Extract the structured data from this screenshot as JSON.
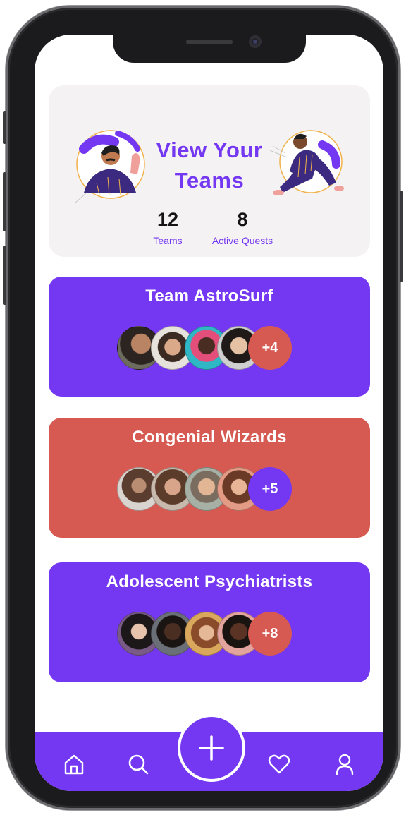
{
  "hero": {
    "title_line1": "View Your",
    "title_line2": "Teams",
    "stats": [
      {
        "value": "12",
        "label": "Teams"
      },
      {
        "value": "8",
        "label": "Active Quests"
      }
    ]
  },
  "teams": [
    {
      "name": "Team AstroSurf",
      "extra": "+4",
      "color": "#7538f2",
      "badge_color": "#d65a52"
    },
    {
      "name": "Congenial Wizards",
      "extra": "+5",
      "color": "#d65a52",
      "badge_color": "#7538f2"
    },
    {
      "name": "Adolescent Psychiatrists",
      "extra": "+8",
      "color": "#7538f2",
      "badge_color": "#d65a52"
    }
  ],
  "nav": {
    "items": [
      "home-icon",
      "search-icon",
      "plus-icon",
      "heart-icon",
      "user-icon"
    ]
  },
  "colors": {
    "accent": "#7538f2",
    "coral": "#d65a52",
    "card_bg": "#f4f2f3"
  }
}
